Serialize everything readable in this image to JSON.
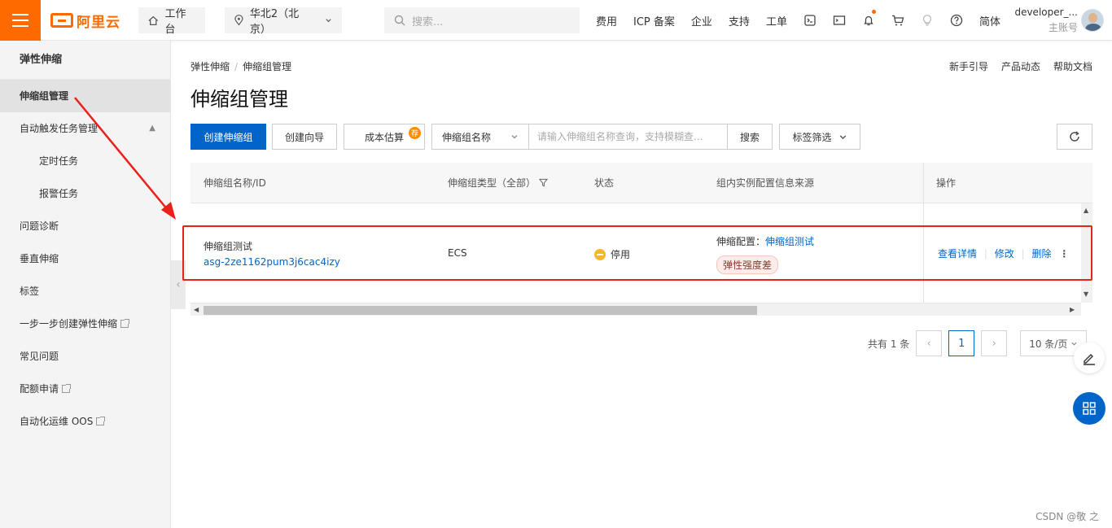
{
  "topbar": {
    "logo_text": "阿里云",
    "workbench": "工作台",
    "region": "华北2（北京）",
    "search_placeholder": "搜索...",
    "links": [
      "费用",
      "ICP 备案",
      "企业",
      "支持",
      "工单"
    ],
    "lang": "简体",
    "user_name": "developer_...",
    "user_role": "主账号"
  },
  "sidebar": {
    "title": "弹性伸缩",
    "items": [
      {
        "label": "伸缩组管理"
      },
      {
        "label": "自动触发任务管理"
      },
      {
        "label": "定时任务"
      },
      {
        "label": "报警任务"
      },
      {
        "label": "问题诊断"
      },
      {
        "label": "垂直伸缩"
      },
      {
        "label": "标签"
      },
      {
        "label": "一步一步创建弹性伸缩"
      },
      {
        "label": "常见问题"
      },
      {
        "label": "配额申请"
      },
      {
        "label": "自动化运维 OOS"
      }
    ]
  },
  "breadcrumb": {
    "root": "弹性伸缩",
    "current": "伸缩组管理"
  },
  "help_links": [
    "新手引导",
    "产品动态",
    "帮助文档"
  ],
  "page_title": "伸缩组管理",
  "toolbar": {
    "create": "创建伸缩组",
    "wizard": "创建向导",
    "cost": "成本估算",
    "cost_badge": "荐",
    "filter_field": "伸缩组名称",
    "search_placeholder": "请输入伸缩组名称查询，支持模糊查...",
    "search_btn": "搜索",
    "tag_filter": "标签筛选"
  },
  "table": {
    "columns": [
      "伸缩组名称/ID",
      "伸缩组类型（全部）",
      "状态",
      "组内实例配置信息来源",
      "操作"
    ],
    "rows": [
      {
        "name": "伸缩组测试",
        "id": "asg-2ze1162pum3j6cac4izy",
        "type": "ECS",
        "status": "停用",
        "config_label": "伸缩配置：",
        "config_link": "伸缩组测试",
        "config_tag": "弹性强度差",
        "actions": [
          "查看详情",
          "修改",
          "删除"
        ]
      }
    ]
  },
  "pagination": {
    "total": "共有 1 条",
    "page": "1",
    "page_size": "10 条/页"
  },
  "watermark": "CSDN @敬 之",
  "colors": {
    "brand": "#ff6a00",
    "primary": "#0064c8",
    "highlight": "#e8211b",
    "warning": "#f8b62d"
  }
}
